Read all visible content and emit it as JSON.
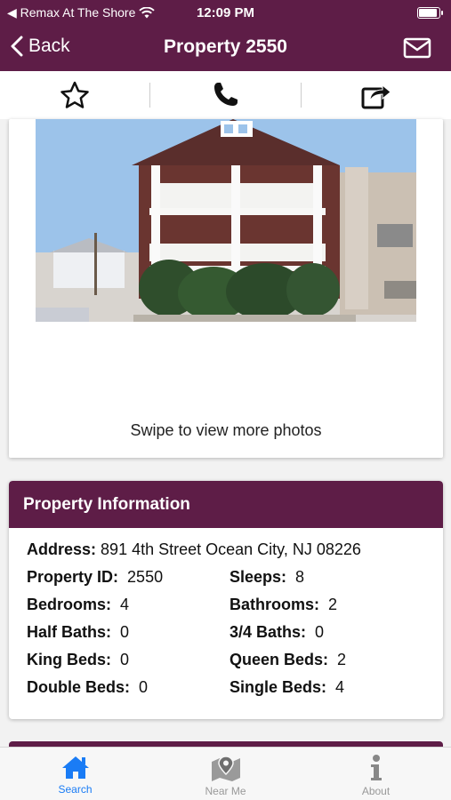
{
  "status_bar": {
    "carrier": "◀ Remax At The Shore",
    "time": "12:09 PM"
  },
  "nav": {
    "back_label": "Back",
    "title": "Property 2550"
  },
  "photo": {
    "caption": "Swipe to view more photos"
  },
  "property_info": {
    "header": "Property Information",
    "address_label": "Address:",
    "address_value": "891 4th Street Ocean City, NJ 08226",
    "rows": [
      [
        {
          "label": "Property ID:",
          "value": "2550"
        },
        {
          "label": "Sleeps:",
          "value": "8"
        }
      ],
      [
        {
          "label": "Bedrooms:",
          "value": "4"
        },
        {
          "label": "Bathrooms:",
          "value": "2"
        }
      ],
      [
        {
          "label": "Half Baths:",
          "value": "0"
        },
        {
          "label": "3/4 Baths:",
          "value": "0"
        }
      ],
      [
        {
          "label": "King Beds:",
          "value": "0"
        },
        {
          "label": "Queen Beds:",
          "value": "2"
        }
      ],
      [
        {
          "label": "Double Beds:",
          "value": "0"
        },
        {
          "label": "Single Beds:",
          "value": "4"
        }
      ]
    ]
  },
  "tabs": [
    {
      "label": "Search",
      "icon": "home-icon",
      "active": true
    },
    {
      "label": "Near Me",
      "icon": "map-pin-icon",
      "active": false
    },
    {
      "label": "About",
      "icon": "info-icon",
      "active": false
    }
  ],
  "colors": {
    "brand": "#5e1d47",
    "tab_active": "#1a7cf5",
    "tab_inactive": "#999999"
  }
}
